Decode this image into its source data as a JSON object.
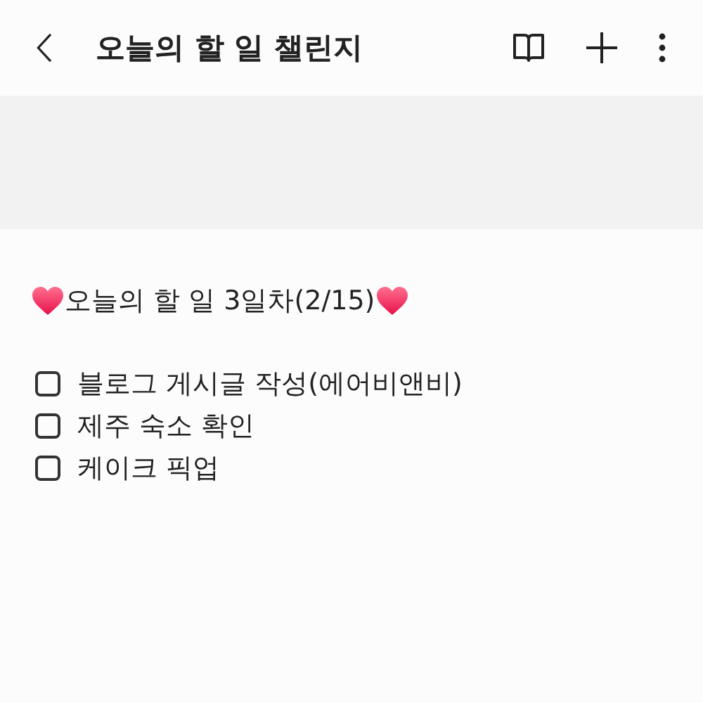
{
  "header": {
    "title": "오늘의 할 일 챌린지"
  },
  "note": {
    "heading": "오늘의 할 일 3일차(2/15)",
    "checklist": [
      {
        "text": "블로그 게시글 작성(에어비앤비)",
        "checked": false
      },
      {
        "text": "제주 숙소 확인",
        "checked": false
      },
      {
        "text": "케이크 픽업",
        "checked": false
      }
    ]
  }
}
